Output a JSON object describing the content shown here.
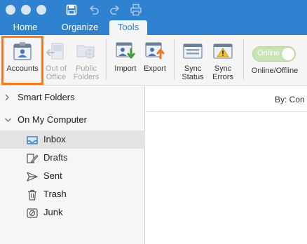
{
  "tabs": [
    {
      "label": "Home",
      "active": false
    },
    {
      "label": "Organize",
      "active": false
    },
    {
      "label": "Tools",
      "active": true
    }
  ],
  "ribbon": {
    "accounts": {
      "label": "Accounts",
      "selected": true
    },
    "out_of_office": {
      "line1": "Out of",
      "line2": "Office",
      "disabled": true
    },
    "public_folders": {
      "line1": "Public",
      "line2": "Folders",
      "disabled": true
    },
    "import": {
      "label": "Import"
    },
    "export": {
      "label": "Export"
    },
    "sync_status": {
      "line1": "Sync",
      "line2": "Status"
    },
    "sync_errors": {
      "line1": "Sync",
      "line2": "Errors"
    },
    "online_toggle": {
      "state_label": "Online",
      "caption": "Online/Offline"
    }
  },
  "sidebar": {
    "smart_folders": {
      "label": "Smart Folders",
      "expanded": false
    },
    "on_my_computer": {
      "label": "On My Computer",
      "expanded": true,
      "folders": [
        {
          "label": "Inbox",
          "icon": "inbox-icon",
          "selected": true
        },
        {
          "label": "Drafts",
          "icon": "drafts-icon"
        },
        {
          "label": "Sent",
          "icon": "sent-icon"
        },
        {
          "label": "Trash",
          "icon": "trash-icon"
        },
        {
          "label": "Junk",
          "icon": "junk-icon"
        }
      ]
    }
  },
  "main": {
    "sort_label": "By: Con"
  },
  "colors": {
    "accent": "#2f82cf",
    "highlight": "#f47b20",
    "online": "#c9e4b4"
  }
}
